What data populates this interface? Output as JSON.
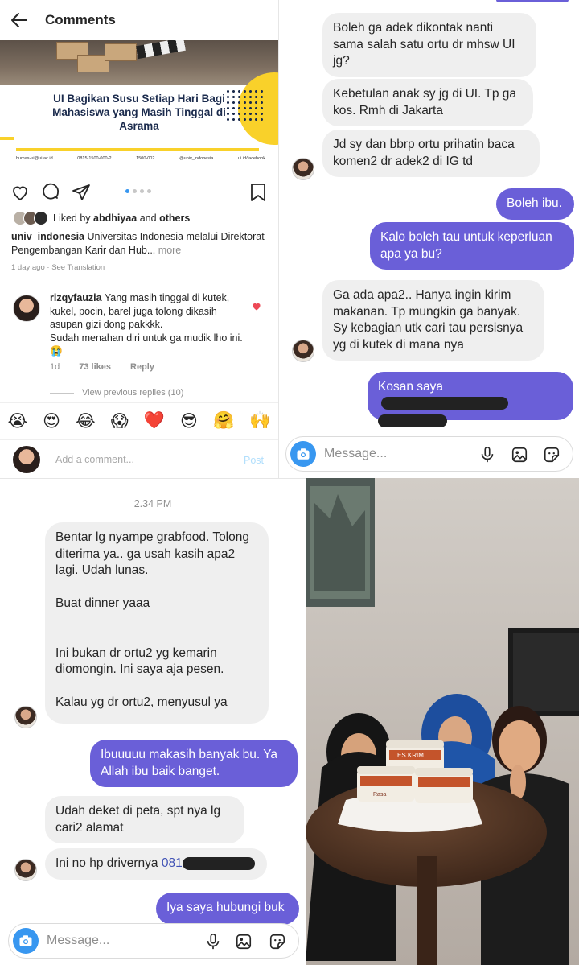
{
  "post_panel": {
    "header": {
      "title": "Comments",
      "back_icon": "arrow-left-icon"
    },
    "post": {
      "headline": "UI Bagikan Susu Setiap Hari Bagi Mahasiswa yang Masih Tinggal di Asrama",
      "contacts": [
        "humas-ui@ui.ac.id",
        "0815-1500-000-2",
        "1500-002",
        "@univ_indonesia",
        "ui.id/facebook"
      ],
      "accent_color": "#f9d12a",
      "carousel_dots": 4,
      "carousel_active": 0
    },
    "likes": {
      "prefix": "Liked by",
      "user": "abdhiyaa",
      "and": "and",
      "others": "others"
    },
    "caption": {
      "username": "univ_indonesia",
      "text": "Universitas Indonesia melalui Direktorat Pengembangan Karir dan Hub...",
      "more": "more"
    },
    "meta": {
      "time": "1 day ago",
      "dot": " · ",
      "translate": "See Translation"
    },
    "comment": {
      "username": "rizqyfauzia",
      "text": "Yang masih tinggal di kutek, kukel, pocin, barel juga tolong dikasih asupan gizi dong pakkkk.",
      "text2": "Sudah menahan diri untuk ga mudik lho ini. 😭",
      "time": "1d",
      "likes": "73 likes",
      "reply": "Reply"
    },
    "view_replies": "View previous replies (10)",
    "emojis": [
      "😭",
      "😍",
      "😂",
      "😱",
      "❤️",
      "😎",
      "🤗",
      "🙌"
    ],
    "add_comment": {
      "placeholder": "Add a comment...",
      "post": "Post"
    }
  },
  "dm_top": {
    "messages": [
      {
        "side": "in",
        "text": "Boleh ga adek dikontak nanti sama salah satu ortu dr mhsw UI jg?"
      },
      {
        "side": "in",
        "text": "Kebetulan anak sy jg di UI. Tp ga kos. Rmh di Jakarta"
      },
      {
        "side": "in",
        "text": "Jd sy dan bbrp ortu prihatin baca komen2 dr adek2 di IG td"
      },
      {
        "side": "out",
        "text": "Boleh ibu."
      },
      {
        "side": "out",
        "text": "Kalo boleh tau untuk keperluan apa ya bu?"
      },
      {
        "side": "in",
        "text": "Ga ada apa2.. Hanya ingin kirim makanan. Tp mungkin ga banyak. Sy kebagian utk cari tau persisnya yg di kutek di mana nya"
      },
      {
        "side": "out",
        "text": "Kosan saya"
      }
    ],
    "composer": {
      "placeholder": "Message..."
    }
  },
  "dm_bottom": {
    "timestamp": "2.34 PM",
    "messages": [
      {
        "side": "in",
        "text": "Bentar lg nyampe grabfood. Tolong diterima ya.. ga usah kasih apa2 lagi. Udah lunas."
      },
      {
        "side": "in",
        "text": "Buat dinner yaaa"
      },
      {
        "side": "in",
        "text": "Ini bukan dr ortu2 yg kemarin diomongin. Ini saya aja pesen."
      },
      {
        "side": "in",
        "text": "Kalau yg dr ortu2, menyusul ya"
      },
      {
        "side": "out",
        "text": "Ibuuuuu makasih banyak bu. Ya Allah ibu baik banget."
      },
      {
        "side": "in",
        "text": "Udah deket di peta, spt nya lg cari2 alamat"
      },
      {
        "side": "in",
        "text": "Ini no hp drivernya",
        "link": "081"
      },
      {
        "side": "out",
        "text": "Iya saya hubungi buk"
      }
    ],
    "composer": {
      "placeholder": "Message..."
    }
  },
  "photo": {
    "cup_label": "ES KRIM",
    "cup_sub": "Rasa"
  }
}
